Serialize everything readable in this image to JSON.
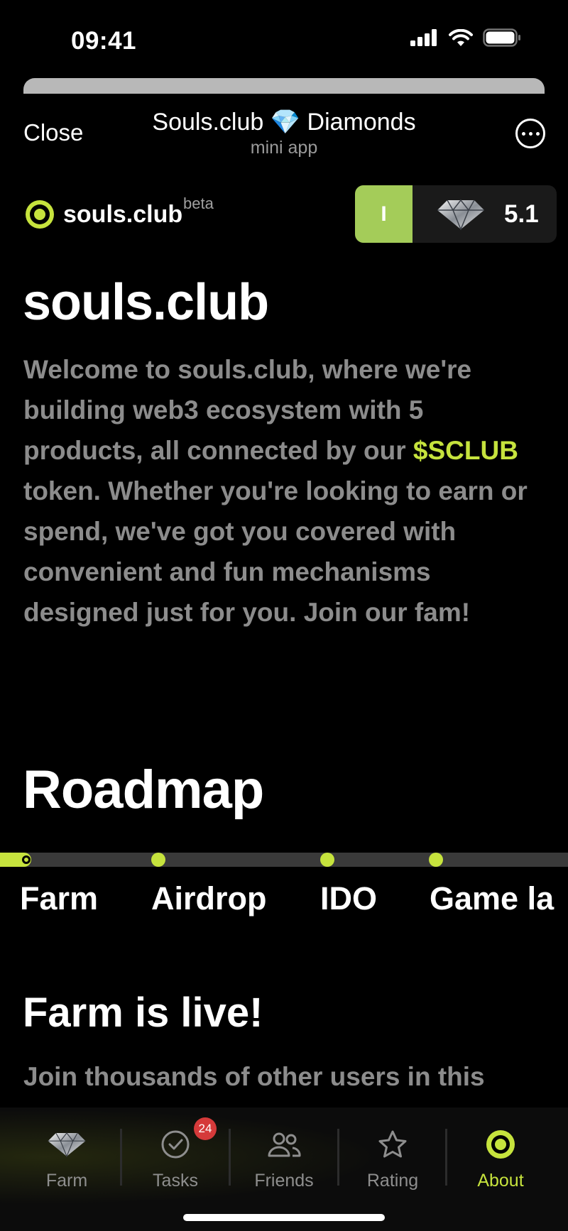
{
  "status_bar": {
    "time": "09:41"
  },
  "header": {
    "close_label": "Close",
    "title_before": "Souls.club",
    "title_emoji": "💎",
    "title_after": "Diamonds",
    "subtitle": "mini app"
  },
  "brand": {
    "name": "souls.club",
    "tag": "beta"
  },
  "balance": {
    "level": "I",
    "amount": "5.1"
  },
  "about": {
    "title": "souls.club",
    "intro_part1": "Welcome to souls.club, where we're building web3 ecosystem with 5 products, all connected by our ",
    "token": "$SCLUB",
    "intro_part2": " token. Whether you're looking to earn or spend, we've got you covered with convenient and fun mechanisms designed just for you. Join our fam!"
  },
  "roadmap": {
    "title": "Roadmap",
    "steps": [
      {
        "label": "Farm"
      },
      {
        "label": "Airdrop"
      },
      {
        "label": "IDO"
      },
      {
        "label": "Game la"
      }
    ]
  },
  "farm_section": {
    "title": "Farm is live!",
    "text": "Join thousands of other users in this"
  },
  "tabs": [
    {
      "label": "Farm",
      "icon": "diamond-icon"
    },
    {
      "label": "Tasks",
      "icon": "check-circle-icon",
      "badge": "24"
    },
    {
      "label": "Friends",
      "icon": "people-icon"
    },
    {
      "label": "Rating",
      "icon": "star-icon"
    },
    {
      "label": "About",
      "icon": "souls-logo-icon",
      "active": true
    }
  ],
  "colors": {
    "accent": "#c6e33d",
    "level_bg": "#a4cc59",
    "badge": "#d53a3a",
    "muted_text": "#8c8c8c"
  }
}
